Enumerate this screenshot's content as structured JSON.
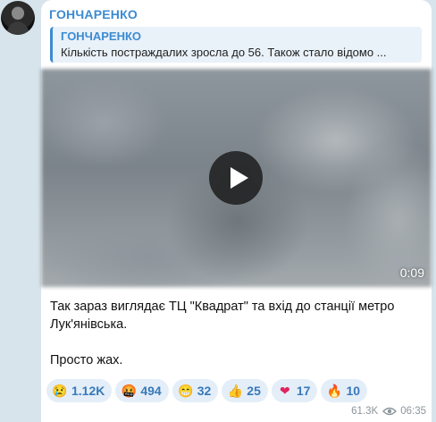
{
  "channel": {
    "name": "ГОНЧАРЕНКО"
  },
  "reply": {
    "author": "ГОНЧАРЕНКО",
    "text": "Кількість постраждалих зросла до 56. Також стало відомо ..."
  },
  "video": {
    "duration": "0:09"
  },
  "caption": {
    "line1": "Так зараз виглядає ТЦ \"Квадрат\" та вхід до станції метро Лук'янівська.",
    "line2": "Просто жах."
  },
  "reactions": [
    {
      "emoji": "😢",
      "count": "1.12K"
    },
    {
      "emoji": "🤬",
      "count": "494"
    },
    {
      "emoji": "😁",
      "count": "32"
    },
    {
      "emoji": "👍",
      "count": "25"
    },
    {
      "emoji": "❤",
      "count": "17"
    },
    {
      "emoji": "🔥",
      "count": "10"
    }
  ],
  "meta": {
    "views": "61.3K",
    "time": "06:35"
  },
  "colors": {
    "accent": "#3c8bd1",
    "background": "#d8e4ec",
    "reaction_bg": "#e4eef8"
  }
}
